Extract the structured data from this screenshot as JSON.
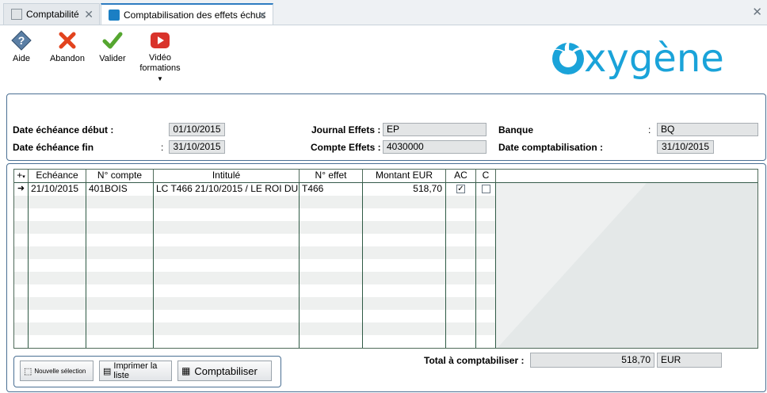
{
  "tabs": [
    {
      "label": "Comptabilité"
    },
    {
      "label": "Comptabilisation des effets échus"
    }
  ],
  "toolbar": {
    "help": "Aide",
    "cancel": "Abandon",
    "validate": "Valider",
    "video1": "Vidéo",
    "video2": "formations"
  },
  "logo": {
    "text": "xygène"
  },
  "filters": {
    "date_debut_label": "Date échéance début :",
    "date_debut": "01/10/2015",
    "date_fin_label": "Date échéance fin",
    "date_fin": "31/10/2015",
    "journal_label": "Journal Effets :",
    "journal": "EP",
    "compte_label": "Compte Effets :",
    "compte": "4030000",
    "banque_label": "Banque",
    "banque": "BQ",
    "date_compta_label": "Date comptabilisation :",
    "date_compta": "31/10/2015"
  },
  "grid": {
    "headers": [
      "Echéance",
      "N° compte",
      "Intitulé",
      "N° effet",
      "Montant EUR",
      "AC",
      "C"
    ],
    "rows": [
      {
        "echeance": "21/10/2015",
        "compte": "401BOIS",
        "intitule": "LC T466 21/10/2015 / LE ROI DU",
        "effet": "T466",
        "montant": "518,70",
        "ac": true,
        "c": false
      }
    ]
  },
  "buttons": {
    "nouvelle": "Nouvelle sélection",
    "imprimer": "Imprimer la liste",
    "comptabiliser": "Comptabiliser"
  },
  "total": {
    "label": "Total à comptabiliser :",
    "value": "518,70",
    "currency": "EUR"
  },
  "colors": {
    "accent": "#2d7cc1",
    "logo": "#1aa3d9"
  }
}
